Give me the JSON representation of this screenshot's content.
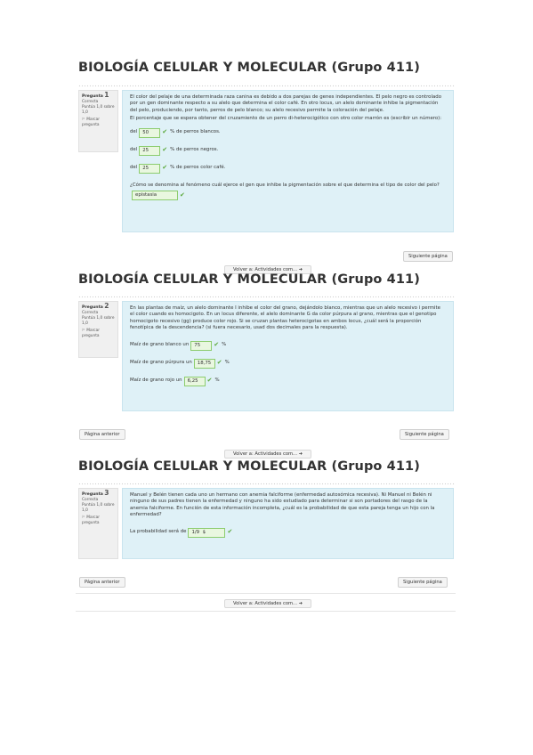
{
  "course_title": "BIOLOGÍA CELULAR Y MOLECULAR (Grupo 411)",
  "question_label": "Pregunta",
  "nav": {
    "next": "Siguiente página",
    "prev": "Página anterior",
    "back": "Volver a: Actividades com... ➜"
  },
  "q1": {
    "number": "1",
    "state": "Correcta",
    "grade": "Puntúa 1,0 sobre 1,0",
    "flag": "Marcar pregunta",
    "text": "El color del pelaje de una determinada raza canina es debido a dos parejas de genes independientes. El pelo negro es controlado por un gen dominante respecto a su alelo que determina el color café. En otro locus, un alelo dominante inhibe la pigmentación del pelo, produciendo, por tanto, perros de pelo blanco; su alelo recesivo permite la coloración del pelaje.",
    "prompt": "El porcentaje que se espera obtener del cruzamiento de un perro di-heterocigótico con otro color marrón es (escribir un número):",
    "answers": [
      {
        "pre": "del",
        "value": "50",
        "post": "% de perros blancos."
      },
      {
        "pre": "del",
        "value": "25",
        "post": "% de perros negros."
      },
      {
        "pre": "del",
        "value": "25",
        "post": "% de perros color café."
      }
    ],
    "q2_prompt": "¿Cómo se denomina al fenómeno cuál ejerce el gen que inhibe la pigmentación sobre el que determina el tipo de color del pelo?",
    "q2_value": "epistasia"
  },
  "q2": {
    "number": "2",
    "state": "Correcta",
    "grade": "Puntúa 1,0 sobre 1,0",
    "flag": "Marcar pregunta",
    "text": "En las plantas de maíz, un alelo dominante I inhibe el color del grano, dejándolo blanco, mientras que un alelo recesivo i permite el color cuando es homocigoto. En un locus diferente, el alelo dominante G da color púrpura al grano, mientras que el genotipo homocigoto recesivo (gg) produce color rojo. Si se cruzan plantas heterocigotas en ambos locus, ¿cuál será la proporción fenotípica de la descendencia? (si fuera necesario, usad dos decimales para la respuesta).",
    "answers": [
      {
        "pre": "Maíz de grano blanco un",
        "value": "75",
        "post": "%"
      },
      {
        "pre": "Maíz de grano púrpura un",
        "value": "18,75",
        "post": "%"
      },
      {
        "pre": "Maíz de grano rojo un",
        "value": "6,25",
        "post": "%"
      }
    ]
  },
  "q3": {
    "number": "3",
    "state": "Correcta",
    "grade": "Puntúa 1,0 sobre 1,0",
    "flag": "Marcar pregunta",
    "text": "Manuel y Belén tienen cada uno un hermano con anemia falciforme (enfermedad autosómica recesiva). Ni Manuel ni Belén ni ninguno de sus padres tienen la enfermedad y ninguno ha sido estudiado para determinar si son portadores del rasgo de la anemia falciforme. En función de esta información incompleta, ¿cuál es la probabilidad de que esta pareja tenga un hijo con la enfermedad?",
    "answer_pre": "La probabilidad será de",
    "answer_value": "1/9",
    "answer_suffix": "$"
  }
}
